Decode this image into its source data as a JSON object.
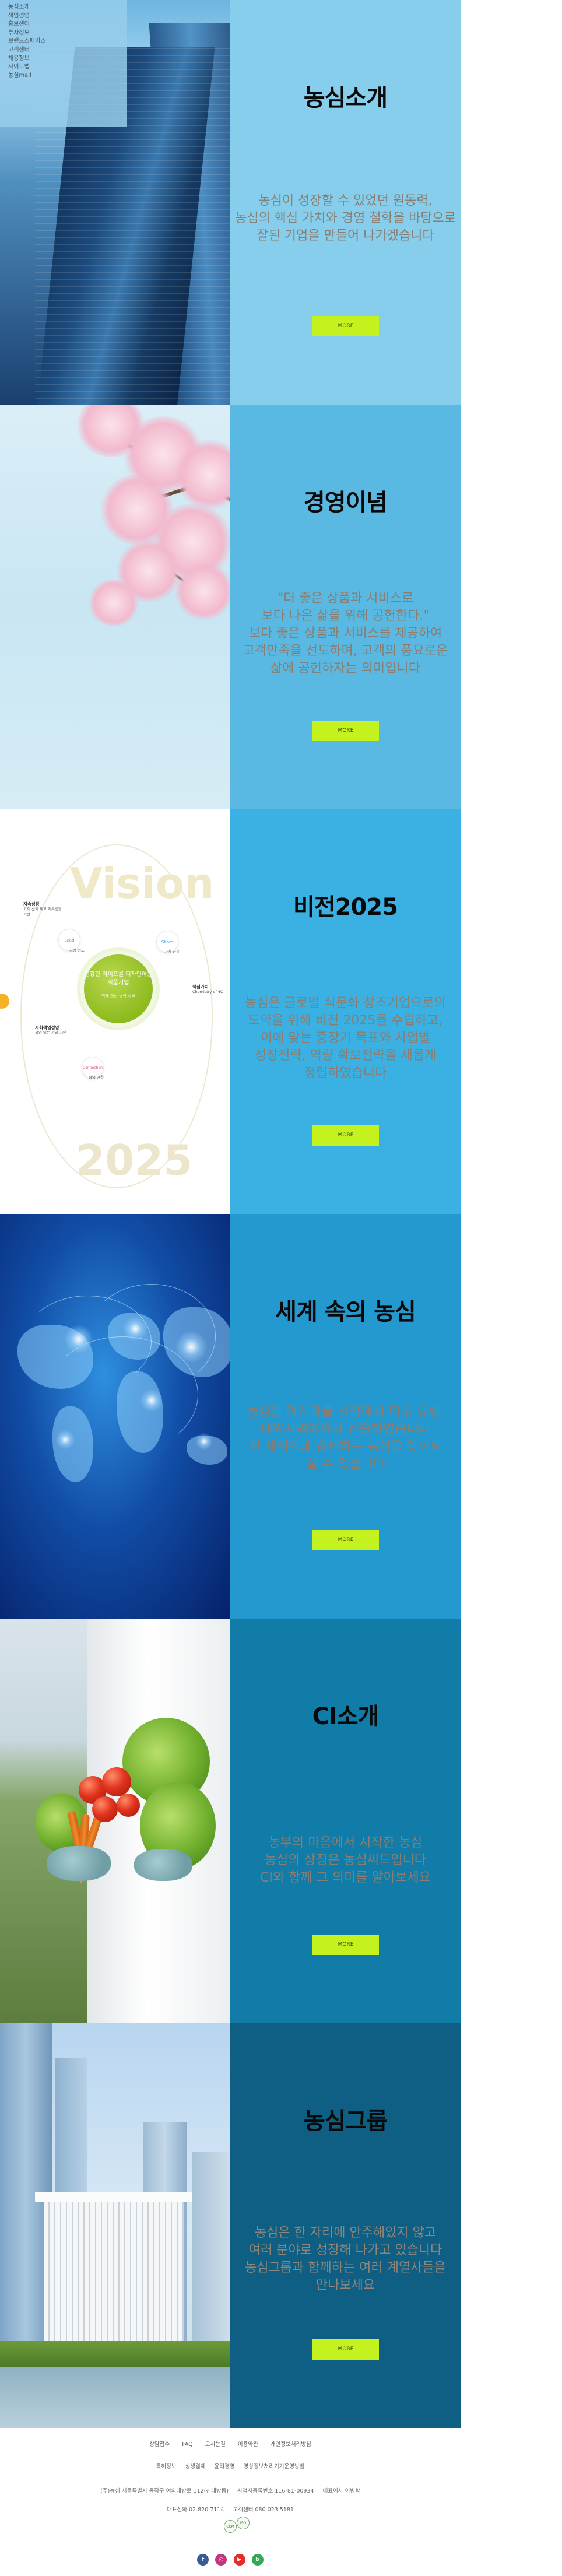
{
  "nav": {
    "items": [
      "농심소개",
      "책임경영",
      "홍보센터",
      "투자정보",
      "브랜드스페이스",
      "고객센터",
      "채용정보",
      "사이트맵",
      "농심mall"
    ]
  },
  "sections": [
    {
      "title": "농심소개",
      "lines": [
        "농심이 성장할 수 있었던 원동력,",
        "농심의 핵심 가치와 경영 철학을 바탕으로",
        "잘된 기업을 만들어 나가겠습니다"
      ],
      "button": "MORE"
    },
    {
      "title": "경영이념",
      "lines": [
        "\"더 좋은 상품과 서비스로",
        "보다 나은 삶을 위해 공헌한다.\"",
        "보다 좋은 상품과 서비스를 제공하여",
        "고객만족을 선도하며, 고객의 풍요로운",
        "삶에 공헌하자는 의미입니다"
      ],
      "button": "MORE"
    },
    {
      "title": "비전2025",
      "lines": [
        "농심은 글로벌 식문화 창조기업으로의",
        "도약을 위해 비전 2025를 수립하고,",
        "이에 맞는 중장기 목표와 사업별",
        "성장전략, 역량 확보전략을 새롭게",
        "정립하였습니다"
      ],
      "button": "MORE"
    },
    {
      "title": "세계 속의 농심",
      "lines": [
        "농심은 아시아를 시작해서 미주 유럽,",
        "대양지역에까지 진출하였습니다",
        "전 세계인과 함께하는 농심을 찾아보",
        "실 수 있습니다"
      ],
      "button": "MORE"
    },
    {
      "title": "CI소개",
      "lines": [
        "농부의 마음에서 시작한 농심",
        "농심의 상징은 농심씨드입니다",
        "CI와 함께 그 의미를 알아보세요"
      ],
      "button": "MORE"
    },
    {
      "title": "농심그룹",
      "lines": [
        "농심은 한 자리에 안주해있지 않고",
        "여러 분야로 성장해 나가고 있습니다",
        "농심그룹과 함께하는 여러 계열사들을",
        "만나보세요"
      ],
      "button": "MORE"
    }
  ],
  "vision_diagram": {
    "watermark_top": "Vision",
    "watermark_bottom": "2025",
    "core_title": "건강한 라이프를 디자인하는 식품기업",
    "core_sub": "미래 성장 동력 확보",
    "left_top_title": "지속성장",
    "left_top_text": "고객 신뢰 제고 지속성장 기반",
    "lead_label": "Lead",
    "lead_text": "시장 선도",
    "share_label": "Share",
    "share_text": "가치 공유",
    "right_title": "핵심가치",
    "right_text": "Chemistry of 4C",
    "left_bottom_title": "사회책임경영",
    "left_bottom_text": "책임 있는 기업 시민",
    "connection_label": "Connection",
    "connection_text": "협업 연결"
  },
  "footer": {
    "links": [
      "상담접수",
      "FAQ",
      "오시는길",
      "이용약관",
      "개인정보처리방침"
    ],
    "links2": [
      "특허정보",
      "상생결제",
      "윤리경영",
      "영상정보처리기기운영방침"
    ],
    "address": "(주)농심 서울특별시 동작구 여의대방로 112(신대방동)",
    "business": "사업자등록번호 116-81-00934",
    "ceo": "대표이사 이병학",
    "phone": "대표전화 02.820.7114",
    "consult": "고객센터 080.023.5181",
    "certs": [
      "CCM",
      "ISO"
    ],
    "social": [
      {
        "name": "facebook",
        "label": "f",
        "color": "#3b5998"
      },
      {
        "name": "instagram",
        "label": "◎",
        "color": "#c13584"
      },
      {
        "name": "youtube",
        "label": "▶",
        "color": "#e52d27"
      },
      {
        "name": "blog",
        "label": "b",
        "color": "#34a853"
      }
    ]
  }
}
